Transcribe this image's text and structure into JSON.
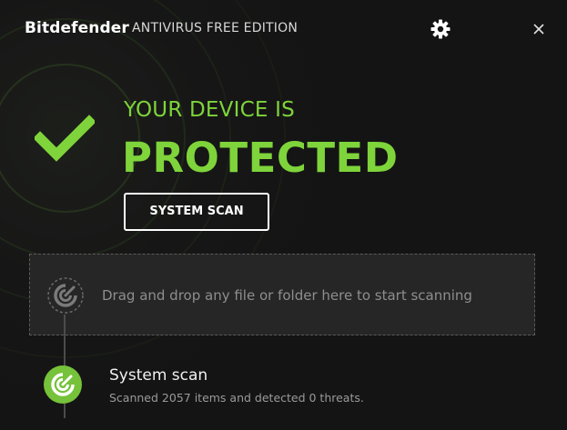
{
  "titlebar": {
    "brand": "Bitdefender",
    "edition": "ANTIVIRUS FREE EDITION",
    "settings_icon": "gear-icon",
    "close_icon": "close-icon"
  },
  "status": {
    "line1": "YOUR DEVICE IS",
    "line2": "PROTECTED",
    "icon": "checkmark-icon",
    "color": "#7ed43a"
  },
  "actions": {
    "system_scan_label": "SYSTEM SCAN"
  },
  "dropzone": {
    "text": "Drag and drop any file or folder here to start scanning",
    "icon": "scan-target-icon"
  },
  "history": {
    "items": [
      {
        "title": "System scan",
        "detail": "Scanned 2057 items and detected 0 threats.",
        "icon": "scan-complete-icon"
      }
    ]
  }
}
